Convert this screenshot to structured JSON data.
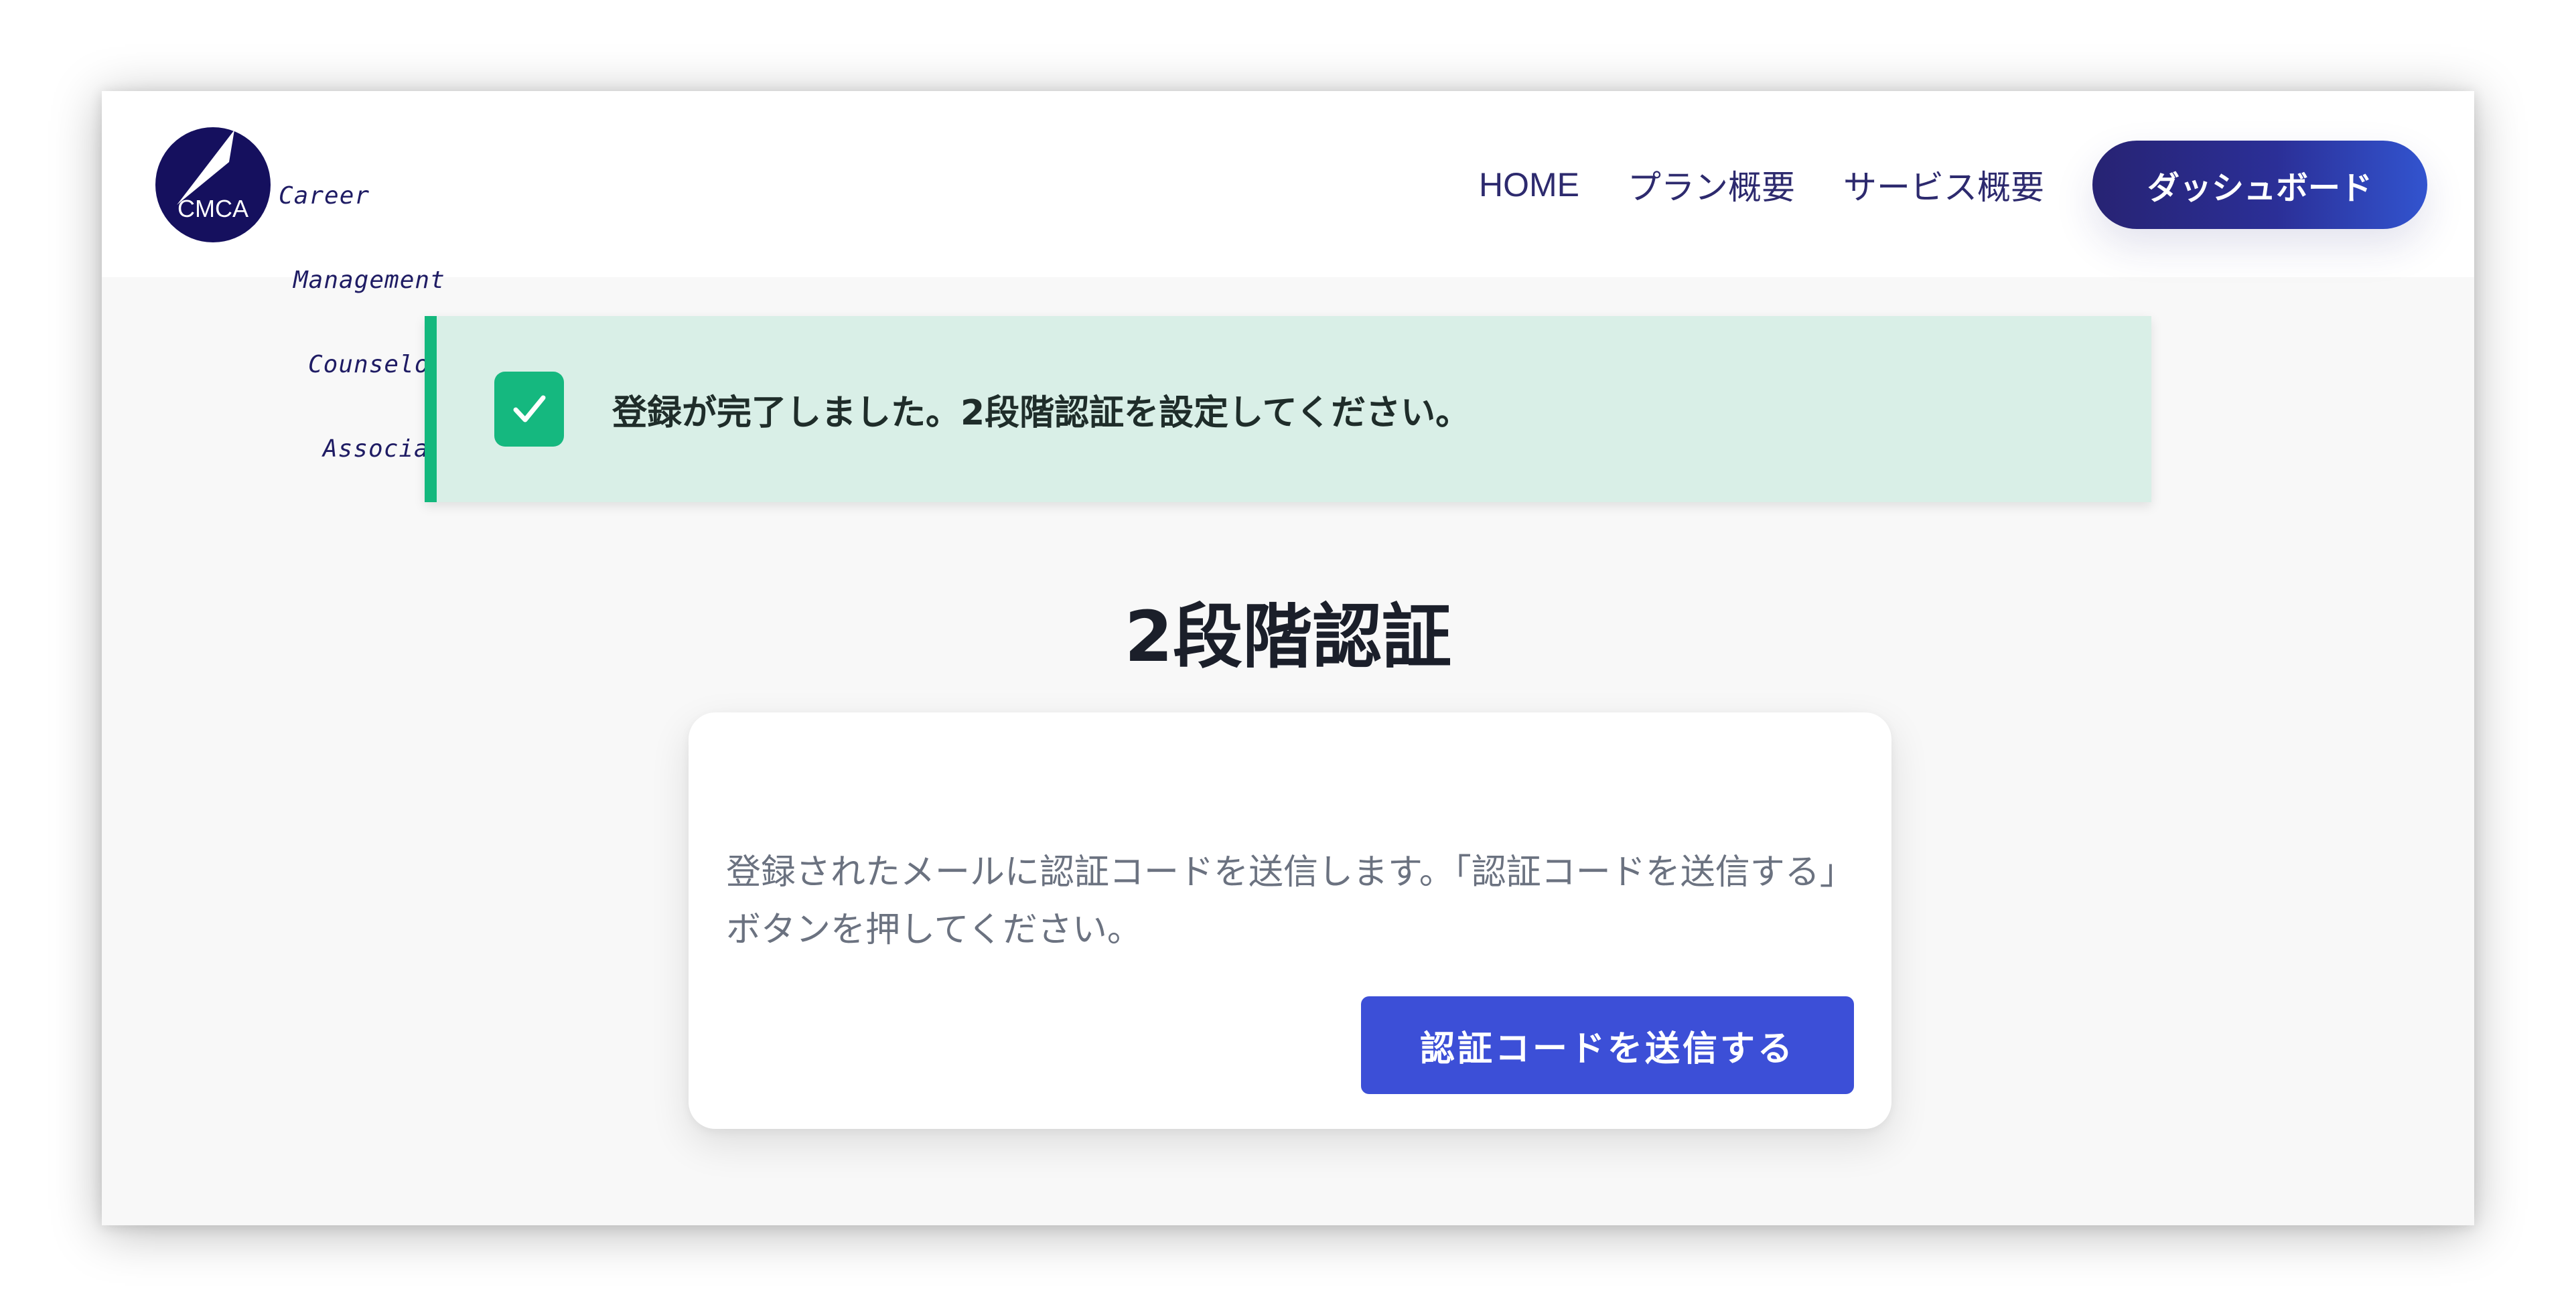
{
  "brand": {
    "logo_mark_text": "CMCA",
    "logo_lines": [
      "Career",
      "Management",
      "Counselor",
      "Association"
    ]
  },
  "nav": {
    "home": "HOME",
    "plans": "プラン概要",
    "services": "サービス概要",
    "dashboard": "ダッシュボード"
  },
  "alert": {
    "message": "登録が完了しました。2段階認証を設定してください。",
    "icon": "check-icon",
    "color": "#13b87d"
  },
  "page": {
    "title": "2段階認証"
  },
  "card": {
    "description": "登録されたメールに認証コードを送信します。「認証コードを送信する」ボタンを押してください。",
    "send_button_label": "認証コードを送信する"
  },
  "colors": {
    "brand_navy": "#1f1c64",
    "primary_button": "#3c4fd7",
    "success": "#13b87d"
  }
}
